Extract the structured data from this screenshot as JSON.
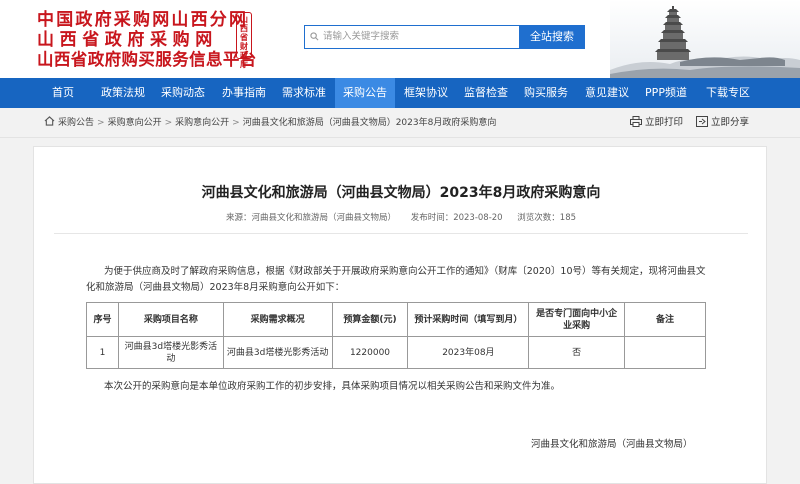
{
  "header": {
    "logo_lines": [
      "中国政府采购网山西分网",
      "山西省政府采购网",
      "山西省政府购买服务信息平台"
    ],
    "seal_text": "山西省财政厅",
    "search_placeholder": "请输入关键字搜索",
    "search_button": "全站搜索"
  },
  "nav": {
    "items": [
      {
        "label": "首页",
        "active": false
      },
      {
        "label": "政策法规",
        "active": false
      },
      {
        "label": "采购动态",
        "active": false
      },
      {
        "label": "办事指南",
        "active": false
      },
      {
        "label": "需求标准",
        "active": false
      },
      {
        "label": "采购公告",
        "active": true
      },
      {
        "label": "框架协议",
        "active": false
      },
      {
        "label": "监督检查",
        "active": false
      },
      {
        "label": "购买服务",
        "active": false
      },
      {
        "label": "意见建议",
        "active": false
      },
      {
        "label": "PPP频道",
        "active": false
      },
      {
        "label": "下载专区",
        "active": false
      }
    ]
  },
  "breadcrumb": {
    "items": [
      "采购公告",
      "采购意向公开",
      "采购意向公开",
      "河曲县文化和旅游局（河曲县文物局）2023年8月政府采购意向"
    ],
    "separator": ">",
    "print_label": "立即打印",
    "share_label": "立即分享"
  },
  "article": {
    "title": "河曲县文化和旅游局（河曲县文物局）2023年8月政府采购意向",
    "source": "来源：河曲县文化和旅游局（河曲县文物局）",
    "publish_time": "发布时间：2023-08-20",
    "views": "浏览次数：185",
    "intro": "为便于供应商及时了解政府采购信息，根据《财政部关于开展政府采购意向公开工作的通知》（财库〔2020〕10号）等有关规定，现将河曲县文化和旅游局（河曲县文物局）2023年8月采购意向公开如下：",
    "table": {
      "headers": [
        "序号",
        "采购项目名称",
        "采购需求概况",
        "预算金额(元)",
        "预计采购时间（填写到月）",
        "是否专门面向中小企业采购",
        "备注"
      ],
      "rows": [
        [
          "1",
          "河曲县3d塔楼光影秀活动",
          "河曲县3d塔楼光影秀活动",
          "1220000",
          "2023年08月",
          "否",
          ""
        ]
      ]
    },
    "closing": "本次公开的采购意向是本单位政府采购工作的初步安排，具体采购项目情况以相关采购公告和采购文件为准。",
    "signature": "河曲县文化和旅游局（河曲县文物局）"
  },
  "colors": {
    "brand_red": "#c8161d",
    "nav_blue": "#1765c1",
    "nav_active": "#3b8ae4",
    "search_blue": "#1f6fcf"
  }
}
